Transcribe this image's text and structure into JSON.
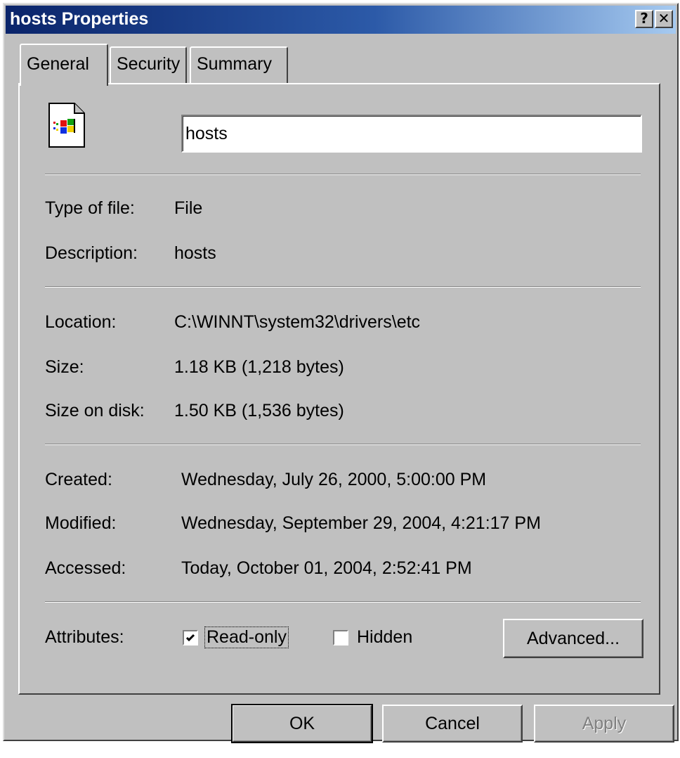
{
  "window": {
    "title": "hosts Properties",
    "help_glyph": "?",
    "close_glyph": "✕"
  },
  "tabs": [
    {
      "label": "General",
      "active": true
    },
    {
      "label": "Security",
      "active": false
    },
    {
      "label": "Summary",
      "active": false
    }
  ],
  "general": {
    "file_name": "hosts",
    "file_icon": "windows-file-icon",
    "type_label": "Type of file:",
    "type_value": "File",
    "description_label": "Description:",
    "description_value": "hosts",
    "location_label": "Location:",
    "location_value": "C:\\WINNT\\system32\\drivers\\etc",
    "size_label": "Size:",
    "size_value": "1.18 KB (1,218 bytes)",
    "size_on_disk_label": "Size on disk:",
    "size_on_disk_value": "1.50 KB (1,536 bytes)",
    "created_label": "Created:",
    "created_value": "Wednesday, July 26, 2000, 5:00:00 PM",
    "modified_label": "Modified:",
    "modified_value": "Wednesday, September 29, 2004, 4:21:17 PM",
    "accessed_label": "Accessed:",
    "accessed_value": "Today, October 01, 2004, 2:52:41 PM",
    "attributes_label": "Attributes:",
    "readonly_label": "Read-only",
    "readonly_checked": true,
    "hidden_label": "Hidden",
    "hidden_checked": false,
    "advanced_label": "Advanced..."
  },
  "buttons": {
    "ok": "OK",
    "cancel": "Cancel",
    "apply": "Apply"
  },
  "colors": {
    "face": "#c0c0c0",
    "title_start": "#0a246a",
    "title_end": "#a6caf0"
  }
}
